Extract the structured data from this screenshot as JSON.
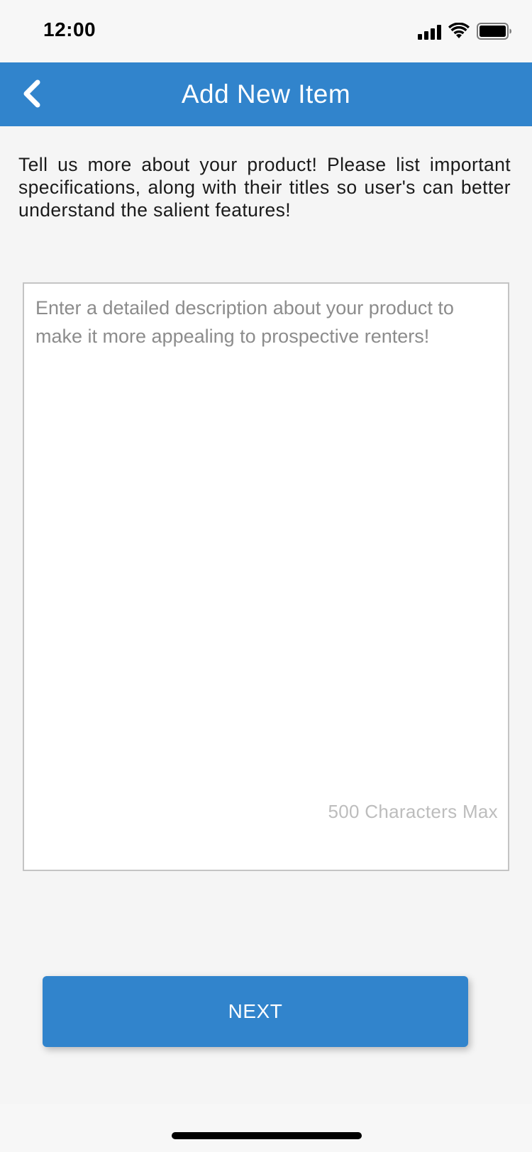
{
  "status_bar": {
    "time": "12:00",
    "icons": [
      "signal-icon",
      "wifi-icon",
      "battery-icon"
    ]
  },
  "nav": {
    "title": "Add New Item",
    "back_icon": "chevron-left-icon"
  },
  "intro": {
    "text": "Tell us more about your product! Please list important specifications, along with their titles so user's can better understand the salient features!"
  },
  "description": {
    "placeholder": "Enter a detailed description about your product to make it more appealing to prospective renters!",
    "value": "",
    "char_limit_label": "500 Characters Max"
  },
  "actions": {
    "next_label": "NEXT"
  },
  "colors": {
    "accent": "#3184cc",
    "background": "#f5f5f5",
    "placeholder": "#8c8c8c",
    "hint": "#bdbdbd"
  }
}
